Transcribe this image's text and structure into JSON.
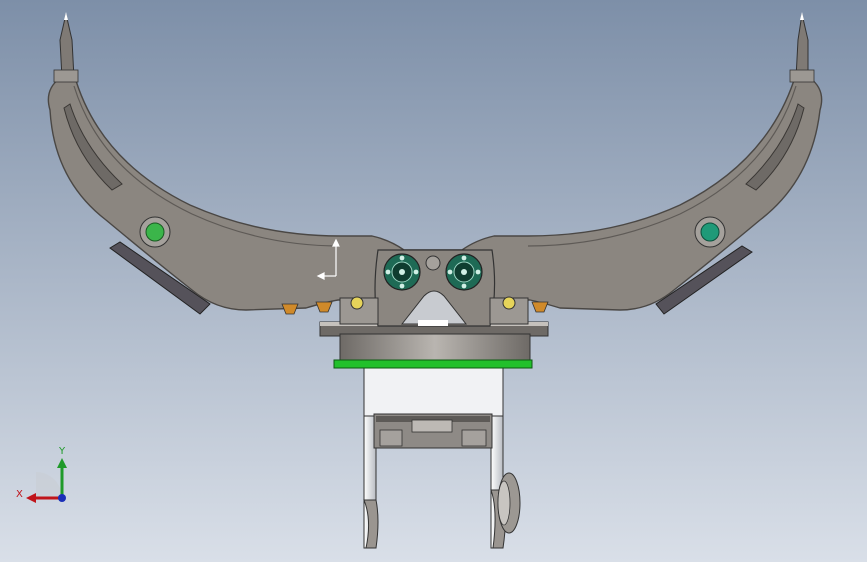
{
  "viewport": {
    "background_top": "#7d8fa8",
    "background_bottom": "#d9dfe8"
  },
  "triad": {
    "x_label": "X",
    "y_label": "Y",
    "x_color": "#c0141b",
    "y_color": "#1f9a2a",
    "z_color": "#1a2fb8"
  },
  "colors": {
    "body": "#8b8680",
    "body_edge": "#4a4744",
    "pad": "#55525a",
    "green_marker": "#3bb54a",
    "teal_marker": "#1f9a78",
    "ring_highlight": "#22c02b"
  }
}
